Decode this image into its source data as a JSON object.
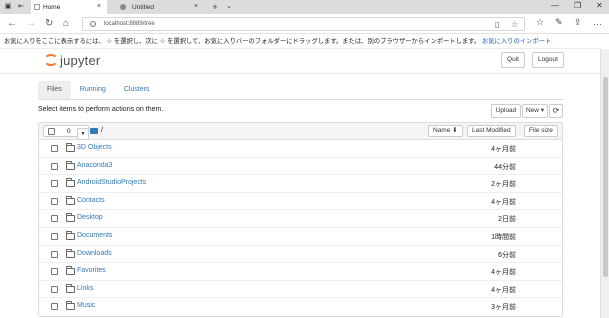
{
  "browser": {
    "tabs": [
      {
        "title": "Home",
        "close": "×"
      },
      {
        "title": "Untitled",
        "close": "×"
      }
    ],
    "new_tab_icon": "+",
    "tab_list_icon": "chevron-down",
    "window_controls": [
      "—",
      "❐",
      "✕"
    ],
    "url": "localhost:8889/tree",
    "favorites_bar": {
      "message": "お気に入りをここに表示するには、 ☆ を選択し、次に ☆ を選択して、お気に入りバーのフォルダーにドラッグします。または、別のブラウザーからインポートします。",
      "import_link": "お気に入りのインポート"
    }
  },
  "header": {
    "logo_text": "jupyter",
    "quit_label": "Quit",
    "logout_label": "Logout"
  },
  "tabs": [
    {
      "label": "Files"
    },
    {
      "label": "Running"
    },
    {
      "label": "Clusters"
    }
  ],
  "toolbar": {
    "instructions": "Select items to perform actions on them.",
    "upload_label": "Upload",
    "new_label": "New ▾",
    "refresh_icon": "refresh"
  },
  "list_header": {
    "selected_count": "0",
    "breadcrumb": "/",
    "name_label": "Name ⬇",
    "last_modified_label": "Last Modified",
    "file_size_label": "File size"
  },
  "files": [
    {
      "name": "3D Objects",
      "modified": "4ヶ月前"
    },
    {
      "name": "Anaconda3",
      "modified": "44分前"
    },
    {
      "name": "AndroidStudioProjects",
      "modified": "2ヶ月前"
    },
    {
      "name": "Contacts",
      "modified": "4ヶ月前"
    },
    {
      "name": "Desktop",
      "modified": "2日前"
    },
    {
      "name": "Documents",
      "modified": "1時間前"
    },
    {
      "name": "Downloads",
      "modified": "6分前"
    },
    {
      "name": "Favorites",
      "modified": "4ヶ月前"
    },
    {
      "name": "Links",
      "modified": "4ヶ月前"
    },
    {
      "name": "Music",
      "modified": "3ヶ月前"
    }
  ],
  "colors": {
    "link": "#337ab7",
    "jupyter_orange": "#f37726"
  }
}
